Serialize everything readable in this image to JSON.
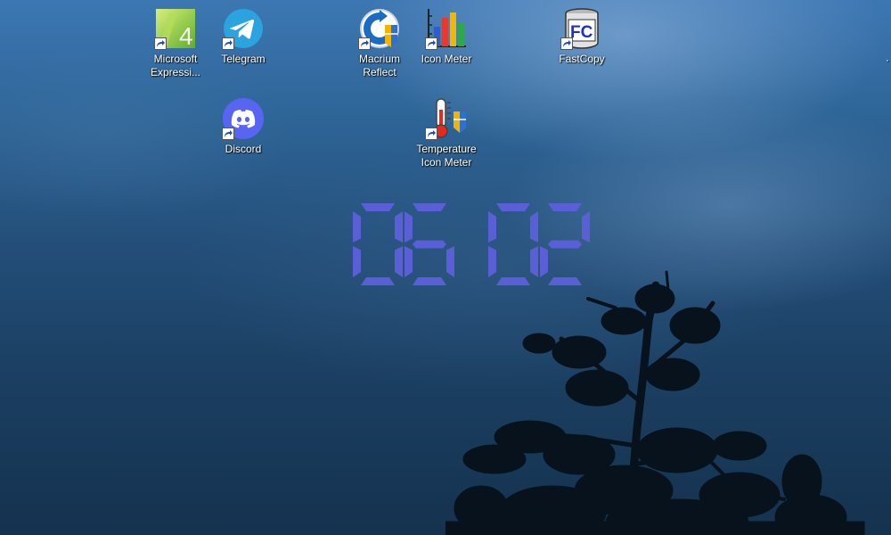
{
  "desktop": {
    "icons": [
      {
        "label": "Microsoft\nExpressi...",
        "icon": "microsoft-expression-icon"
      },
      {
        "label": "Telegram",
        "icon": "telegram-icon"
      },
      {
        "label": "Macrium\nReflect",
        "icon": "macrium-reflect-icon"
      },
      {
        "label": "Icon Meter",
        "icon": "icon-meter-icon"
      },
      {
        "label": "FastCopy",
        "icon": "fastcopy-icon"
      },
      {
        "label": "Discord",
        "icon": "discord-icon"
      },
      {
        "label": "Temperature\nIcon Meter",
        "icon": "temperature-icon-meter-icon"
      }
    ]
  },
  "clock": {
    "hours": "06",
    "minutes": "02",
    "color": "#5b5fd6"
  },
  "colors": {
    "telegram": "#2aa3de",
    "discord": "#5865f2",
    "fastcopy": "#1a2fd6"
  }
}
